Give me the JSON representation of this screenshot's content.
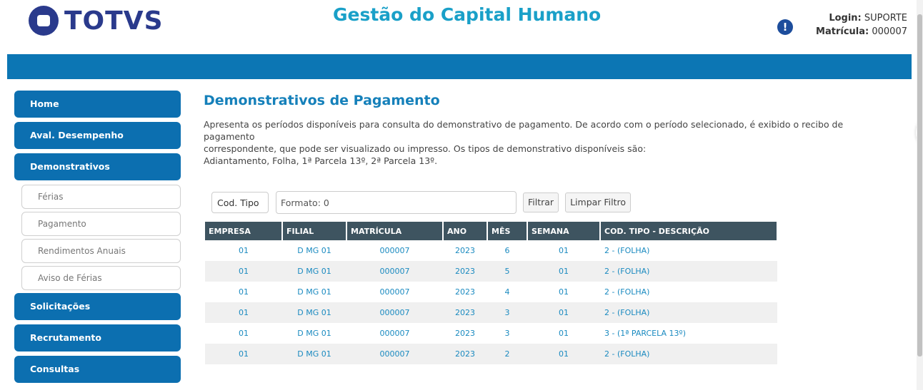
{
  "header": {
    "logo_text": "TOTVS",
    "app_title": "Gestão do Capital Humano",
    "alert_icon": "!",
    "login_label": "Login:",
    "login_value": "SUPORTE",
    "matricula_label": "Matrícula:",
    "matricula_value": "000007"
  },
  "sidebar": {
    "items": [
      {
        "label": "Home"
      },
      {
        "label": "Aval. Desempenho"
      },
      {
        "label": "Demonstrativos"
      },
      {
        "label": "Férias"
      },
      {
        "label": "Pagamento"
      },
      {
        "label": "Rendimentos Anuais"
      },
      {
        "label": "Aviso de Férias"
      },
      {
        "label": "Solicitações"
      },
      {
        "label": "Recrutamento"
      },
      {
        "label": "Consultas"
      }
    ]
  },
  "main": {
    "title": "Demonstrativos de Pagamento",
    "desc_line1": "Apresenta os períodos disponíveis para consulta do demonstrativo de pagamento. De acordo com o período selecionado, é exibido o recibo de pagamento",
    "desc_line2": "correspondente, que pode ser visualizado ou impresso. Os tipos de demonstrativo disponíveis são:",
    "desc_line3": "Adiantamento, Folha, 1ª Parcela 13º, 2ª Parcela 13º.",
    "filter": {
      "select_value": "Cod. Tipo",
      "input_value": "Formato: 0",
      "filter_button": "Filtrar",
      "clear_button": "Limpar Filtro"
    },
    "table": {
      "columns": [
        "EMPRESA",
        "FILIAL",
        "MATRÍCULA",
        "ANO",
        "MÊS",
        "SEMANA",
        "COD. TIPO - DESCRIÇÃO"
      ],
      "rows": [
        [
          "01",
          "D MG 01",
          "000007",
          "2023",
          "6",
          "01",
          "2 - (FOLHA)"
        ],
        [
          "01",
          "D MG 01",
          "000007",
          "2023",
          "5",
          "01",
          "2 - (FOLHA)"
        ],
        [
          "01",
          "D MG 01",
          "000007",
          "2023",
          "4",
          "01",
          "2 - (FOLHA)"
        ],
        [
          "01",
          "D MG 01",
          "000007",
          "2023",
          "3",
          "01",
          "2 - (FOLHA)"
        ],
        [
          "01",
          "D MG 01",
          "000007",
          "2023",
          "3",
          "01",
          "3 - (1ª PARCELA 13º)"
        ],
        [
          "01",
          "D MG 01",
          "000007",
          "2023",
          "2",
          "01",
          "2 - (FOLHA)"
        ]
      ]
    }
  },
  "colors": {
    "brand_blue": "#0c76b4",
    "title_cyan": "#1aa0c8",
    "header_dark": "#3e5460",
    "link_blue": "#1a8ac0"
  }
}
